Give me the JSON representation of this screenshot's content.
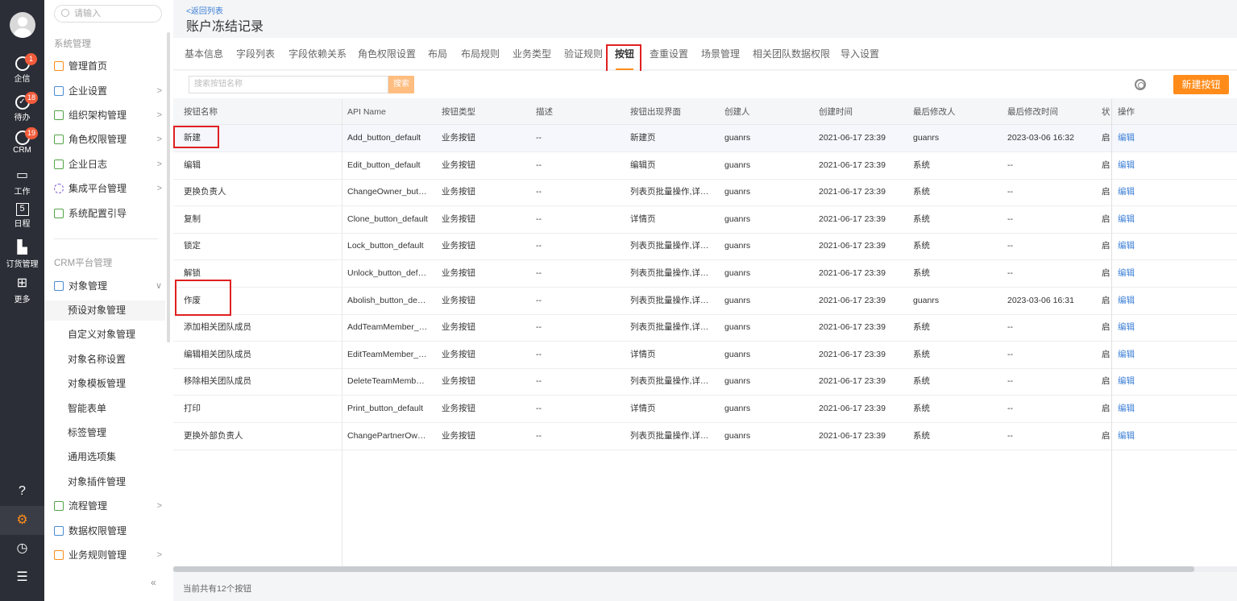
{
  "rail": {
    "items": [
      {
        "label": "企信",
        "badge": "1",
        "icon": "chat-icon"
      },
      {
        "label": "待办",
        "badge": "18",
        "icon": "check-circle-icon"
      },
      {
        "label": "CRM",
        "badge": "19",
        "icon": "clock-icon"
      },
      {
        "label": "工作",
        "icon": "briefcase-icon"
      },
      {
        "label": "日程",
        "icon": "calendar-icon",
        "day": "5"
      },
      {
        "label": "订货管理",
        "icon": "bar-chart-icon"
      },
      {
        "label": "更多",
        "icon": "grid-icon"
      }
    ],
    "bottom": [
      {
        "icon": "help-icon",
        "glyph": "?"
      },
      {
        "icon": "gear-icon",
        "glyph": "⚙"
      },
      {
        "icon": "history-icon",
        "glyph": "◷"
      },
      {
        "icon": "user-settings-icon",
        "glyph": "☰"
      }
    ]
  },
  "sidebar": {
    "search_placeholder": "请输入",
    "section1": "系统管理",
    "items1": [
      {
        "label": "管理首页"
      },
      {
        "label": "企业设置"
      },
      {
        "label": "组织架构管理"
      },
      {
        "label": "角色权限管理"
      },
      {
        "label": "企业日志"
      },
      {
        "label": "集成平台管理"
      },
      {
        "label": "系统配置引导"
      }
    ],
    "section2": "CRM平台管理",
    "object_mgmt": "对象管理",
    "sub_items": [
      {
        "label": "预设对象管理"
      },
      {
        "label": "自定义对象管理"
      },
      {
        "label": "对象名称设置"
      },
      {
        "label": "对象模板管理"
      },
      {
        "label": "智能表单"
      },
      {
        "label": "标签管理"
      },
      {
        "label": "通用选项集"
      },
      {
        "label": "对象插件管理"
      }
    ],
    "items2": [
      {
        "label": "流程管理"
      },
      {
        "label": "数据权限管理"
      },
      {
        "label": "业务规则管理"
      }
    ],
    "collapse": "«"
  },
  "header": {
    "back": "<返回列表",
    "title": "账户冻结记录"
  },
  "tabs": [
    "基本信息",
    "字段列表",
    "字段依赖关系",
    "角色权限设置",
    "布局",
    "布局规则",
    "业务类型",
    "验证规则",
    "按钮",
    "查重设置",
    "场景管理",
    "相关团队数据权限",
    "导入设置"
  ],
  "toolbar": {
    "search_placeholder": "搜索按钮名称",
    "search_label": "搜索",
    "new_button": "新建按钮"
  },
  "table": {
    "columns": [
      "按钮名称",
      "API Name",
      "按钮类型",
      "描述",
      "按钮出现界面",
      "创建人",
      "创建时间",
      "最后修改人",
      "最后修改时间",
      "状态",
      "操作"
    ],
    "rows": [
      [
        "新建",
        "Add_button_default",
        "业务按钮",
        "--",
        "新建页",
        "guanrs",
        "2021-06-17 23:39",
        "guanrs",
        "2023-03-06 16:32",
        "启用",
        "编辑"
      ],
      [
        "编辑",
        "Edit_button_default",
        "业务按钮",
        "--",
        "编辑页",
        "guanrs",
        "2021-06-17 23:39",
        "系统",
        "--",
        "启用",
        "编辑"
      ],
      [
        "更换负责人",
        "ChangeOwner_button_default",
        "业务按钮",
        "--",
        "列表页批量操作,详情页",
        "guanrs",
        "2021-06-17 23:39",
        "系统",
        "--",
        "启用",
        "编辑"
      ],
      [
        "复制",
        "Clone_button_default",
        "业务按钮",
        "--",
        "详情页",
        "guanrs",
        "2021-06-17 23:39",
        "系统",
        "--",
        "启用",
        "编辑"
      ],
      [
        "锁定",
        "Lock_button_default",
        "业务按钮",
        "--",
        "列表页批量操作,详情页",
        "guanrs",
        "2021-06-17 23:39",
        "系统",
        "--",
        "启用",
        "编辑"
      ],
      [
        "解锁",
        "Unlock_button_default",
        "业务按钮",
        "--",
        "列表页批量操作,详情页",
        "guanrs",
        "2021-06-17 23:39",
        "系统",
        "--",
        "启用",
        "编辑"
      ],
      [
        "作废",
        "Abolish_button_default",
        "业务按钮",
        "--",
        "列表页批量操作,详情页",
        "guanrs",
        "2021-06-17 23:39",
        "guanrs",
        "2023-03-06 16:31",
        "启用",
        "编辑"
      ],
      [
        "添加相关团队成员",
        "AddTeamMember_button_default",
        "业务按钮",
        "--",
        "列表页批量操作,详情页",
        "guanrs",
        "2021-06-17 23:39",
        "系统",
        "--",
        "启用",
        "编辑"
      ],
      [
        "编辑相关团队成员",
        "EditTeamMember_button_default",
        "业务按钮",
        "--",
        "详情页",
        "guanrs",
        "2021-06-17 23:39",
        "系统",
        "--",
        "启用",
        "编辑"
      ],
      [
        "移除相关团队成员",
        "DeleteTeamMember_button_default",
        "业务按钮",
        "--",
        "列表页批量操作,详情页",
        "guanrs",
        "2021-06-17 23:39",
        "系统",
        "--",
        "启用",
        "编辑"
      ],
      [
        "打印",
        "Print_button_default",
        "业务按钮",
        "--",
        "详情页",
        "guanrs",
        "2021-06-17 23:39",
        "系统",
        "--",
        "启用",
        "编辑"
      ],
      [
        "更换外部负责人",
        "ChangePartnerOwner_button_default",
        "业务按钮",
        "--",
        "列表页批量操作,详情页",
        "guanrs",
        "2021-06-17 23:39",
        "系统",
        "--",
        "启用",
        "编辑"
      ]
    ]
  },
  "footer": "当前共有12个按钮",
  "colors": {
    "accent": "#ff8c1a",
    "link": "#3c7fd6",
    "highlight": "#e02020"
  }
}
